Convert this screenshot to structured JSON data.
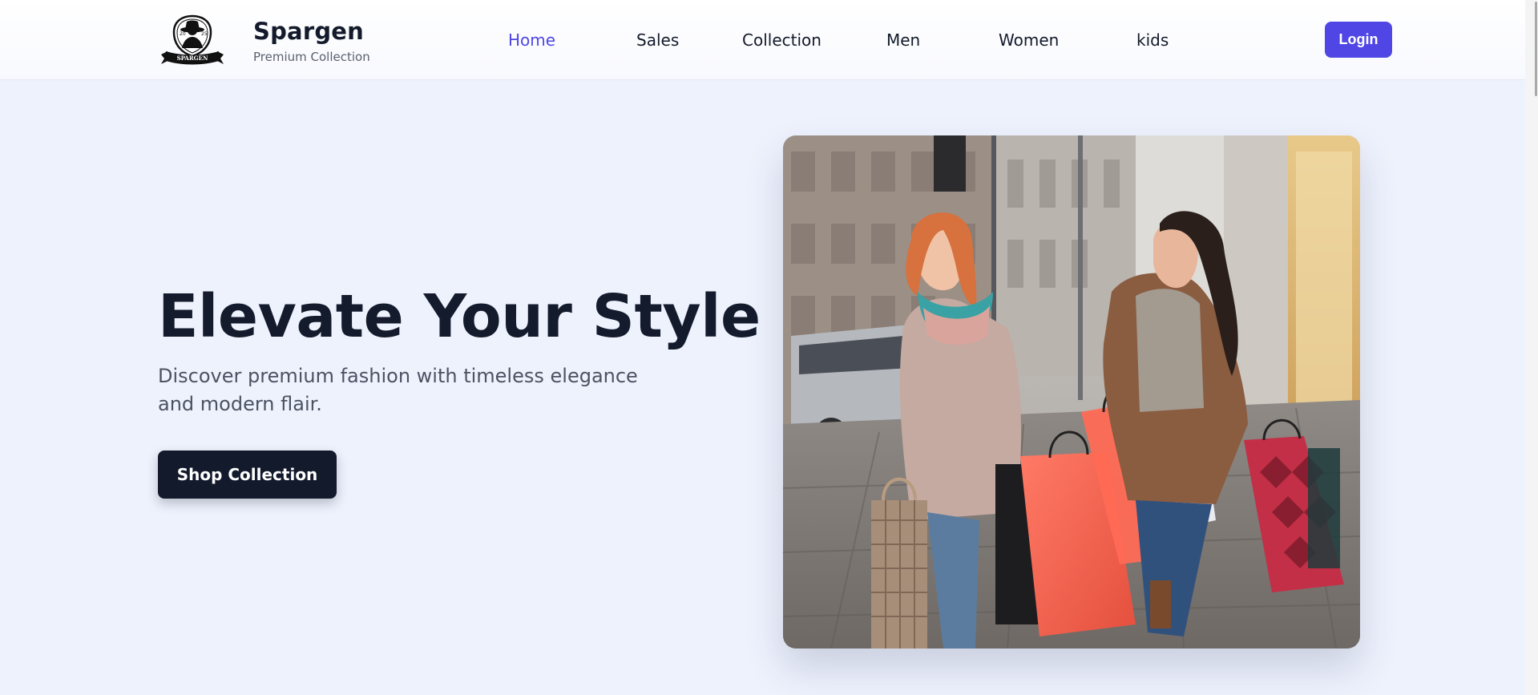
{
  "brand": {
    "name": "Spargen",
    "tagline": "Premium Collection",
    "logo_text": "SPARGEN"
  },
  "nav": {
    "items": [
      {
        "label": "Home",
        "active": true
      },
      {
        "label": "Sales",
        "active": false
      },
      {
        "label": "Collection",
        "active": false
      },
      {
        "label": "Men",
        "active": false
      },
      {
        "label": "Women",
        "active": false
      },
      {
        "label": "kids",
        "active": false
      }
    ],
    "login_label": "Login"
  },
  "hero": {
    "title": "Elevate Your Style",
    "subtitle": "Discover premium fashion with timeless elegance and modern flair.",
    "cta_label": "Shop Collection",
    "image_alt": "Two women laughing while walking down a city street carrying shopping bags"
  },
  "colors": {
    "accent": "#4f46e5",
    "dark": "#131a2b",
    "background": "#eef2fd",
    "text_muted": "#4c5262"
  },
  "icons": {
    "logo": "spy-hat-emblem-icon"
  }
}
